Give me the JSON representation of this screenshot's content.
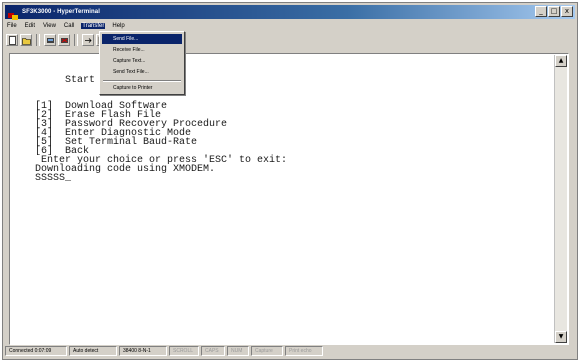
{
  "window": {
    "title": "SF3K3000 - HyperTerminal",
    "controls": {
      "minimize": "_",
      "maximize": "□",
      "close": "x"
    }
  },
  "menubar": {
    "items": [
      {
        "label": "File"
      },
      {
        "label": "Edit"
      },
      {
        "label": "View"
      },
      {
        "label": "Call"
      },
      {
        "label": "Transfer"
      },
      {
        "label": "Help"
      }
    ]
  },
  "toolbar": {
    "buttons": [
      "new-icon",
      "open-icon",
      "call-icon",
      "disconnect-icon",
      "send-icon",
      "properties-icon"
    ]
  },
  "transfer_menu": {
    "items": [
      {
        "label": "Send File..."
      },
      {
        "label": "Receive File..."
      },
      {
        "label": "Capture Text..."
      },
      {
        "label": "Send Text File..."
      },
      {
        "label": "Capture to Printer"
      }
    ]
  },
  "terminal": {
    "lines": [
      "Start",
      "",
      "[1]  Download Software",
      "[2]  Erase Flash File",
      "[3]  Password Recovery Procedure",
      "[4]  Enter Diagnostic Mode",
      "[5]  Set Terminal Baud-Rate",
      "[6]  Back",
      " Enter your choice or press 'ESC' to exit:",
      "Downloading code using XMODEM.",
      "SSSSS_"
    ]
  },
  "statusbar": {
    "cells": [
      {
        "text": "Connected 0:07:09"
      },
      {
        "text": "Auto detect"
      },
      {
        "text": "38400 8-N-1"
      },
      {
        "text": "SCROLL"
      },
      {
        "text": "CAPS"
      },
      {
        "text": "NUM"
      },
      {
        "text": "Capture"
      },
      {
        "text": "Print echo"
      }
    ]
  },
  "colors": {
    "title_bar_start": "#0a246a",
    "title_bar_end": "#a6caf0",
    "chrome": "#d4d0c8",
    "highlight": "#0a246a"
  }
}
